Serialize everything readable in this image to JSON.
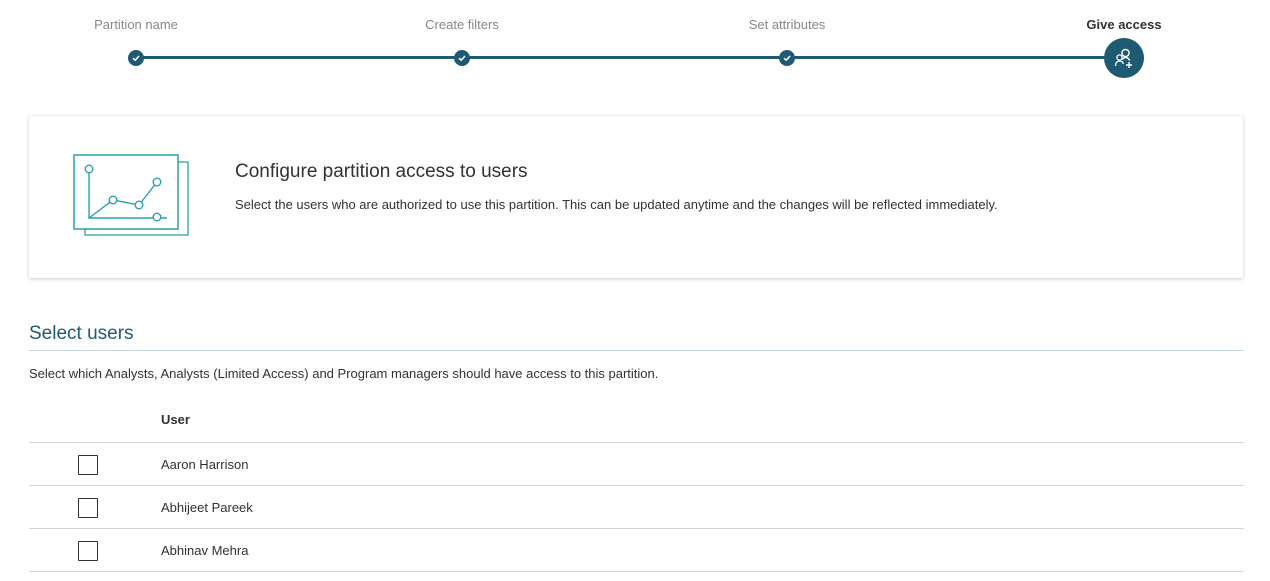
{
  "stepper": {
    "steps": [
      {
        "label": "Partition name",
        "state": "complete"
      },
      {
        "label": "Create filters",
        "state": "complete"
      },
      {
        "label": "Set attributes",
        "state": "complete"
      },
      {
        "label": "Give access",
        "state": "current",
        "icon": "add-user-icon"
      }
    ]
  },
  "info": {
    "title": "Configure partition access to users",
    "description": "Select the users who are authorized to use this partition. This can be updated anytime and the changes will be reflected immediately.",
    "illustration": "line-chart-illustration"
  },
  "select_users": {
    "title": "Select users",
    "description": "Select which Analysts, Analysts (Limited Access) and Program managers should have access to this partition.",
    "table": {
      "column_header": "User",
      "rows": [
        {
          "name": "Aaron Harrison",
          "checked": false
        },
        {
          "name": "Abhijeet Pareek",
          "checked": false
        },
        {
          "name": "Abhinav Mehra",
          "checked": false
        }
      ]
    }
  },
  "colors": {
    "accent": "#1f5a73",
    "illustration": "#2aa1a8",
    "divider": "#d4d4d4"
  }
}
